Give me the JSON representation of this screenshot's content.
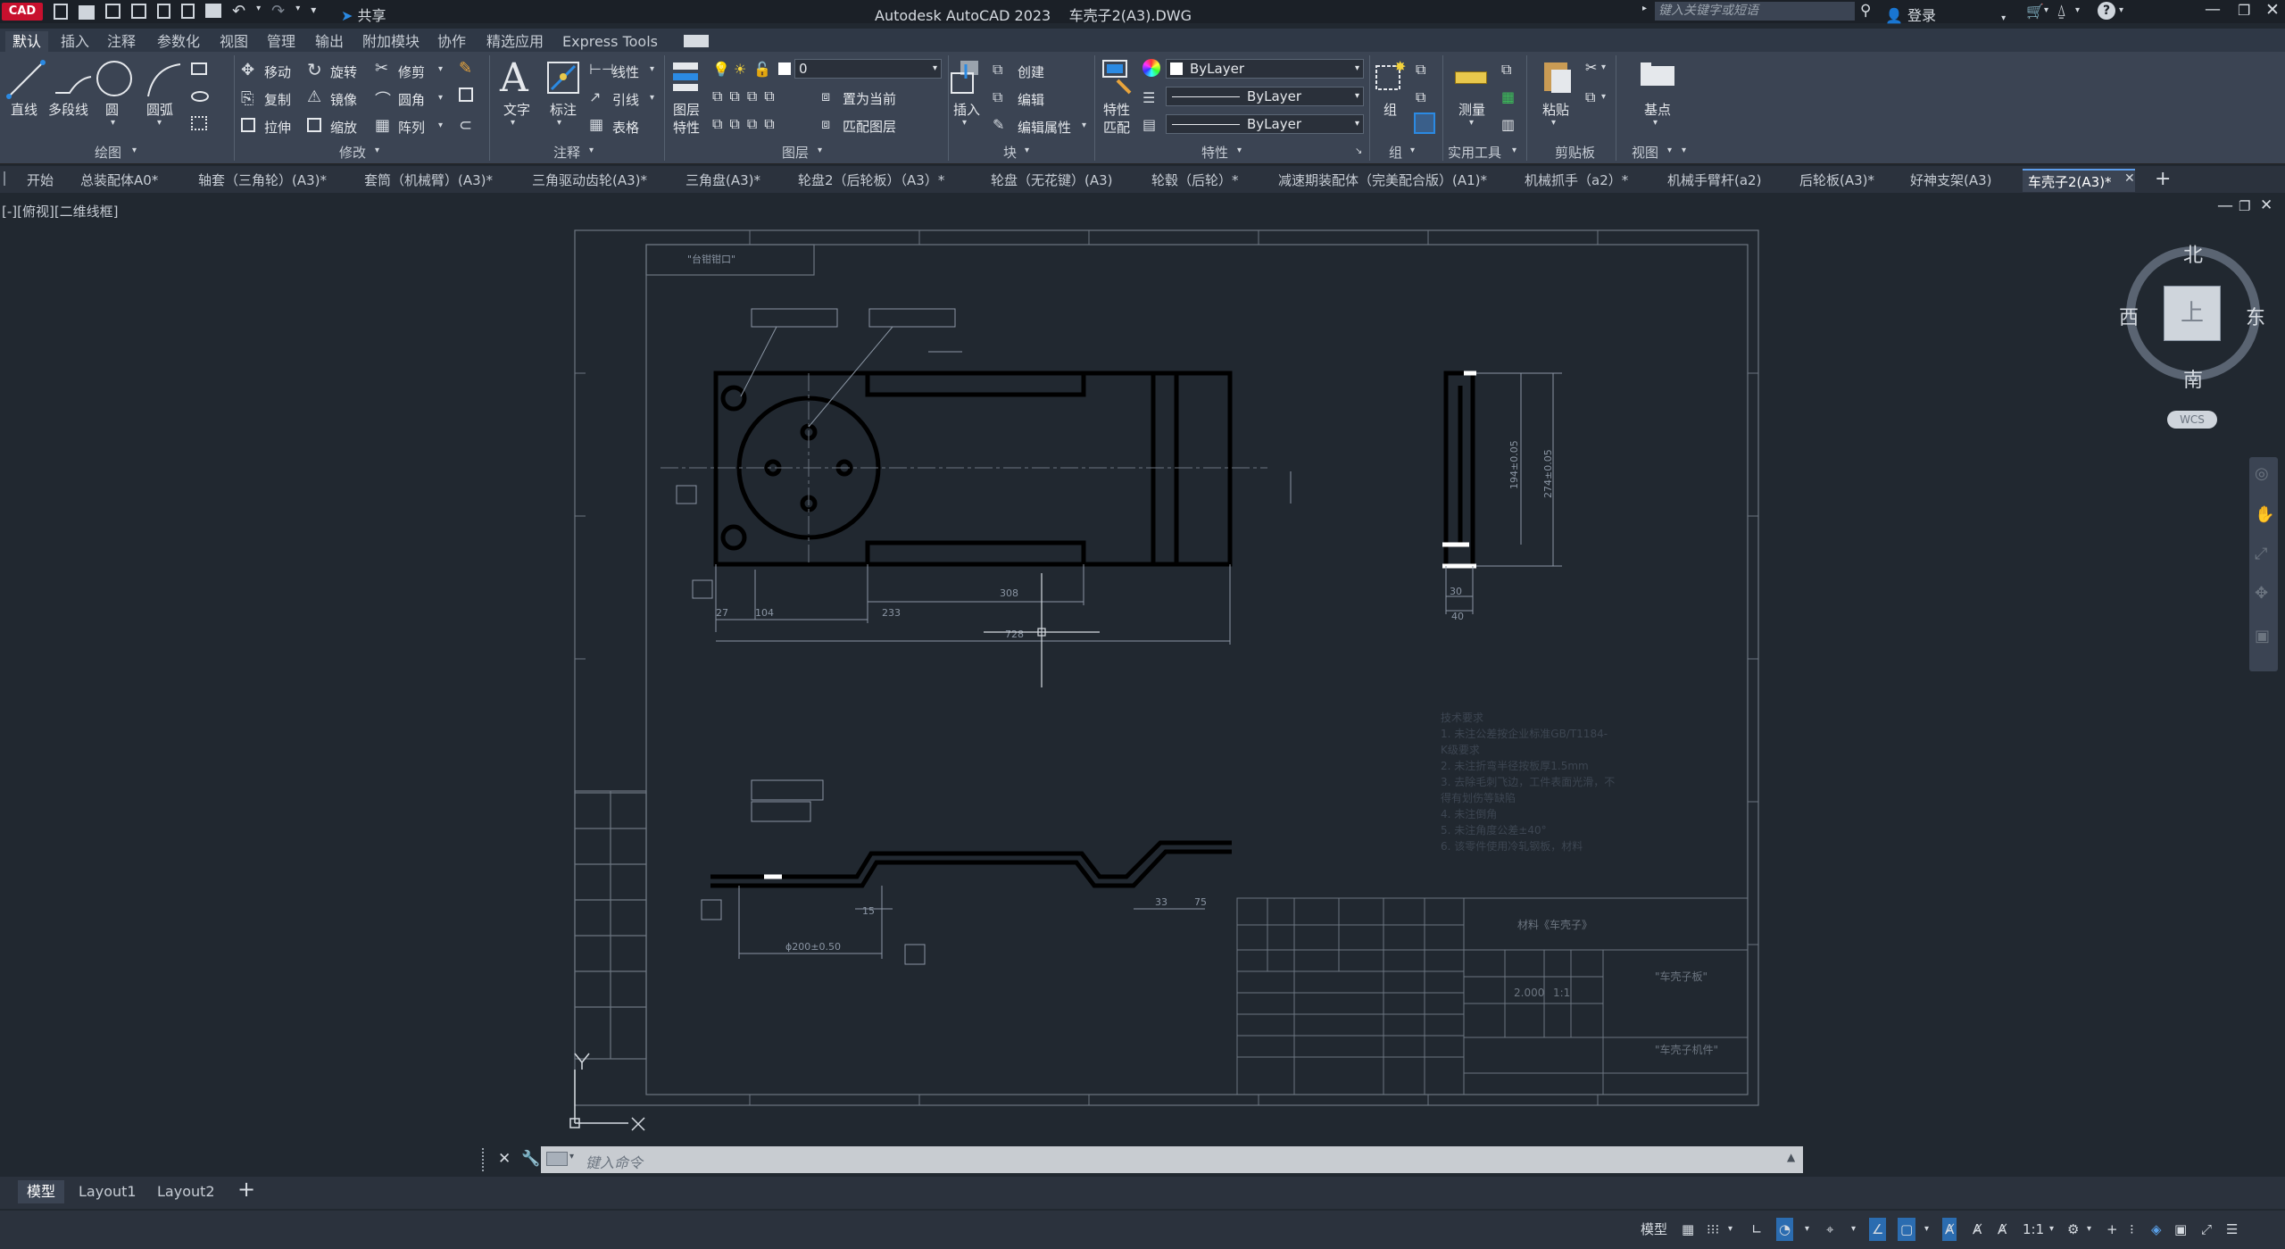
{
  "app": {
    "badge": "CAD",
    "title": "Autodesk AutoCAD 2023",
    "doc": "车壳子2(A3).DWG",
    "share": "共享",
    "search_placeholder": "键入关键字或短语",
    "login": "登录"
  },
  "ribbon_tabs": [
    "默认",
    "插入",
    "注释",
    "参数化",
    "视图",
    "管理",
    "输出",
    "附加模块",
    "协作",
    "精选应用",
    "Express Tools"
  ],
  "draw": {
    "line": "直线",
    "polyline": "多段线",
    "circle": "圆",
    "arc": "圆弧",
    "title": "绘图"
  },
  "modify": {
    "move": "移动",
    "rotate": "旋转",
    "trim": "修剪",
    "copy": "复制",
    "mirror": "镜像",
    "fillet": "圆角",
    "stretch": "拉伸",
    "scale": "缩放",
    "array": "阵列",
    "title": "修改"
  },
  "annot": {
    "text": "文字",
    "dim": "标注",
    "linear": "线性",
    "leader": "引线",
    "table": "表格",
    "title": "注释"
  },
  "layers": {
    "props": "图层",
    "props2": "特性",
    "current_layer": "0",
    "set_current": "置为当前",
    "match": "匹配图层",
    "title": "图层"
  },
  "block": {
    "insert": "插入",
    "create": "创建",
    "edit": "编辑",
    "edit_attr": "编辑属性",
    "title": "块"
  },
  "props": {
    "match": "特性",
    "match2": "匹配",
    "color": "ByLayer",
    "linetype": "ByLayer",
    "lineweight": "ByLayer",
    "title": "特性"
  },
  "groups": {
    "group": "组",
    "title": "组"
  },
  "utilities": {
    "measure": "测量",
    "title": "实用工具"
  },
  "clipboard": {
    "paste": "粘贴",
    "title": "剪贴板"
  },
  "view": {
    "base": "基点",
    "title": "视图"
  },
  "doc_tabs": [
    "开始",
    "总装配体A0*",
    "轴套（三角轮）(A3)*",
    "套筒（机械臂）(A3)*",
    "三角驱动齿轮(A3)*",
    "三角盘(A3)*",
    "轮盘2（后轮板）（A3）*",
    "轮盘（无花键）(A3)",
    "轮毂（后轮）*",
    "减速期装配体（完美配合版）(A1)*",
    "机械抓手（a2）*",
    "机械手臂杆(a2)",
    "后轮板(A3)*",
    "好神支架(A3)",
    "车壳子2(A3)*"
  ],
  "viewport_label": "[-][俯视][二维线框]",
  "viewcube": {
    "north": "北",
    "south": "南",
    "east": "东",
    "west": "西",
    "top": "上",
    "wcs": "WCS"
  },
  "command_placeholder": "键入命令",
  "layout_tabs": [
    "模型",
    "Layout1",
    "Layout2"
  ],
  "status": {
    "model": "模型",
    "scale": "1:1"
  },
  "drawing": {
    "label_top": "\"台钳钳口\"",
    "dims": {
      "d308": "308",
      "d728": "728",
      "d27": "27",
      "d104": "104",
      "d233": "233",
      "d30": "30",
      "d40": "40",
      "d194": "194±0.05",
      "d274": "274±0.05",
      "d15": "15",
      "d33": "33",
      "d75": "75",
      "dphi": "ϕ200±0.50"
    },
    "notes_title": "技术要求",
    "notes": [
      "1. 未注公差按企业标准GB/T1184-",
      "  K级要求",
      "2. 未注折弯半径按板厚1.5mm",
      "3. 去除毛刺飞边，工件表面光滑，不",
      "  得有划伤等缺陷",
      "4. 未注倒角",
      "5. 未注角度公差±40°",
      "6. 该零件使用冷轧钢板，材料"
    ],
    "title_block": {
      "material": "材料《车壳子》",
      "part": "\"车壳子板\"",
      "company": "\"车壳子机件\"",
      "scale": "1:1",
      "qty": "2.000"
    }
  }
}
